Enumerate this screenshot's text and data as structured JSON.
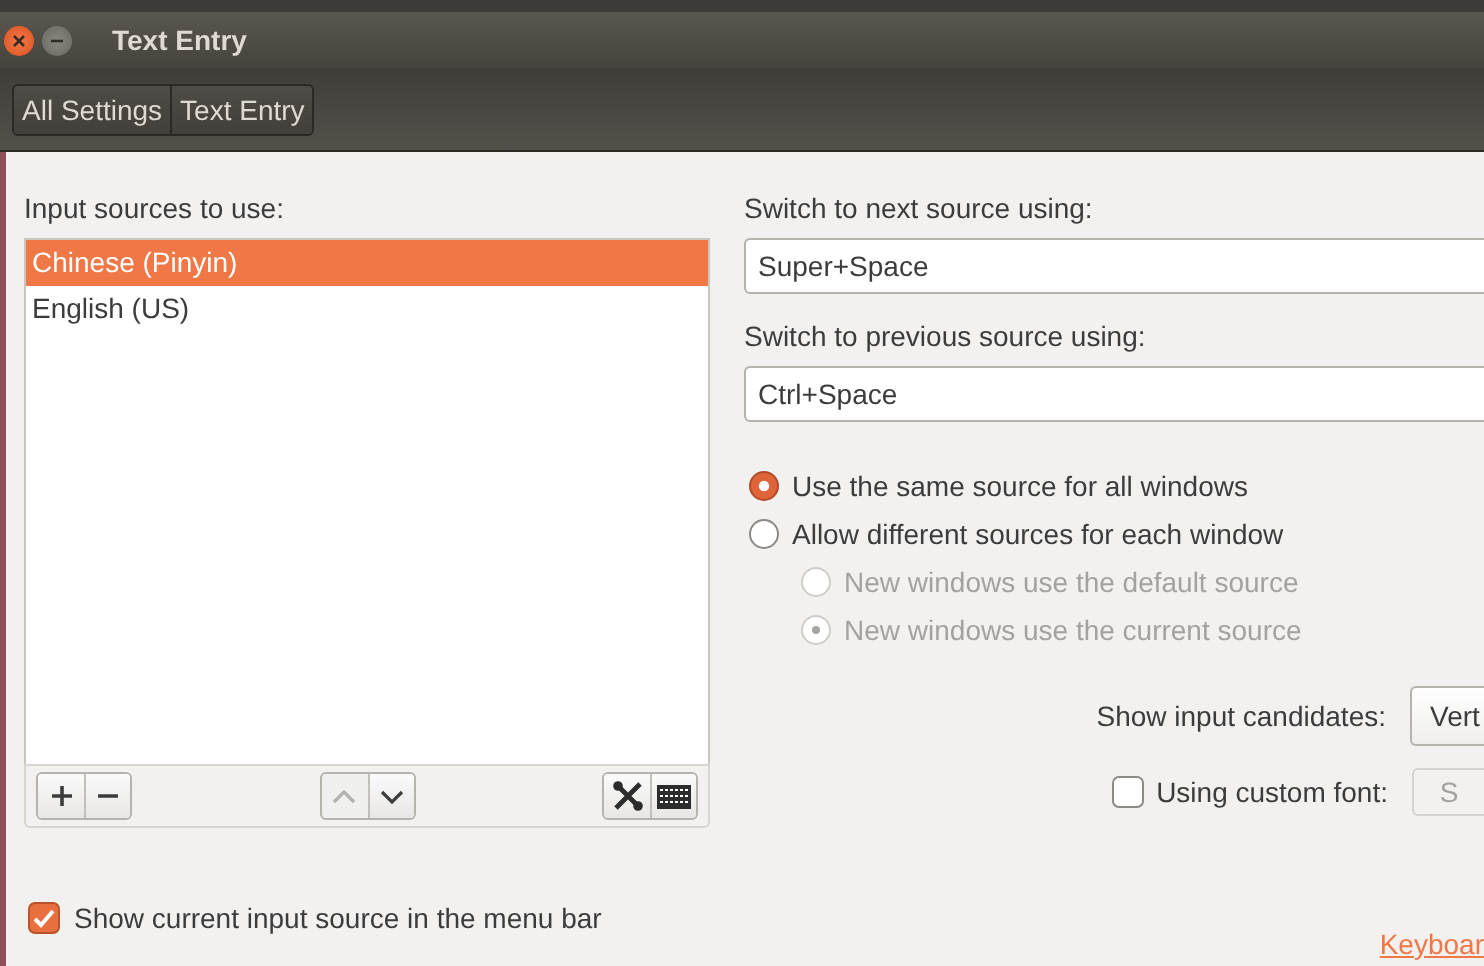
{
  "window": {
    "title": "Text Entry"
  },
  "breadcrumbs": [
    {
      "label": "All Settings"
    },
    {
      "label": "Text Entry"
    }
  ],
  "input_sources": {
    "label": "Input sources to use:",
    "items": [
      {
        "label": "Chinese (Pinyin)",
        "selected": true
      },
      {
        "label": "English (US)",
        "selected": false
      }
    ],
    "toolbar": [
      {
        "buttons": [
          {
            "kind": "add",
            "disabled": false
          },
          {
            "kind": "remove",
            "disabled": false
          }
        ]
      },
      {
        "buttons": [
          {
            "kind": "up",
            "disabled": true
          },
          {
            "kind": "down",
            "disabled": false
          }
        ]
      },
      {
        "buttons": [
          {
            "kind": "settings",
            "disabled": false
          },
          {
            "kind": "keyboard",
            "disabled": false
          }
        ]
      }
    ]
  },
  "switch_next": {
    "label": "Switch to next source using:",
    "value": "Super+Space"
  },
  "switch_previous": {
    "label": "Switch to previous source using:",
    "value": "Ctrl+Space"
  },
  "source_mode": [
    {
      "label": "Use the same source for all windows",
      "selected": true,
      "disabled": false
    },
    {
      "label": "Allow different sources for each window",
      "selected": false,
      "disabled": false,
      "children": [
        {
          "label": "New windows use the default source",
          "selected": false,
          "disabled": true
        },
        {
          "label": "New windows use the current source",
          "selected": true,
          "disabled": true
        }
      ]
    }
  ],
  "candidates": {
    "label": "Show input candidates:",
    "value": "Vert"
  },
  "custom_font": {
    "label": "Using custom font:",
    "checked": false,
    "button": "S",
    "disabled": true
  },
  "show_in_menu_bar": {
    "label": "Show current input source in the menu bar",
    "checked": true
  },
  "keyboard_link": "Keyboar"
}
